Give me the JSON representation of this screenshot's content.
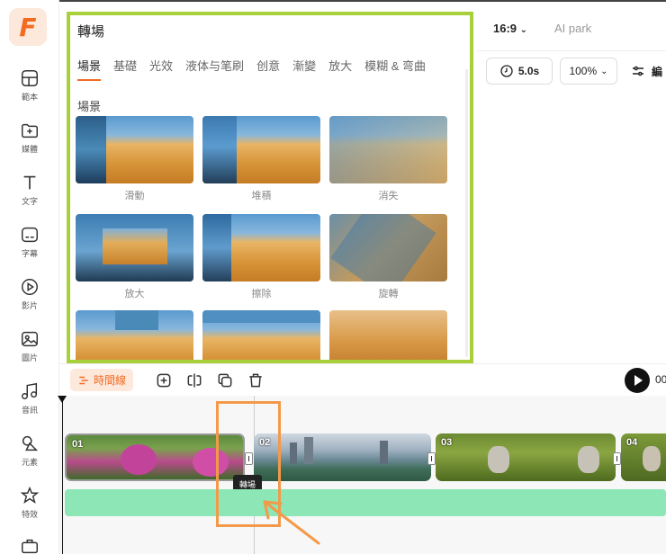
{
  "sidebar": {
    "logo": "F",
    "items": [
      {
        "label": "範本",
        "icon": "template-icon"
      },
      {
        "label": "媒體",
        "icon": "media-upload-icon"
      },
      {
        "label": "文字",
        "icon": "text-icon"
      },
      {
        "label": "字幕",
        "icon": "subtitle-icon"
      },
      {
        "label": "影片",
        "icon": "video-icon"
      },
      {
        "label": "圖片",
        "icon": "image-icon"
      },
      {
        "label": "音訊",
        "icon": "music-icon"
      },
      {
        "label": "元素",
        "icon": "elements-icon"
      },
      {
        "label": "特效",
        "icon": "effects-icon"
      },
      {
        "label": "",
        "icon": "toolbox-icon"
      }
    ]
  },
  "panel": {
    "title": "轉場",
    "tabs": [
      "場景",
      "基礎",
      "光效",
      "液体与笔刷",
      "创意",
      "漸變",
      "放大",
      "模糊 & 弯曲"
    ],
    "active_tab": "場景",
    "section": "場景",
    "items": [
      {
        "label": "滑動"
      },
      {
        "label": "堆積"
      },
      {
        "label": "消失"
      },
      {
        "label": "放大"
      },
      {
        "label": "擦除"
      },
      {
        "label": "旋轉"
      },
      {
        "label": ""
      },
      {
        "label": ""
      },
      {
        "label": ""
      }
    ]
  },
  "toolbar": {
    "aspect_ratio": "16:9",
    "project_name": "AI park",
    "duration": "5.0s",
    "zoom": "100%",
    "adjust_label": "編"
  },
  "timeline": {
    "main_button": "時間線",
    "time": "00",
    "clips": [
      {
        "num": "01"
      },
      {
        "num": "02"
      },
      {
        "num": "03"
      },
      {
        "num": "04"
      }
    ],
    "tooltip": "轉場"
  },
  "colors": {
    "accent": "#f36b21",
    "panel_highlight": "#a8d03a",
    "audio_track": "#8ce6b6",
    "annotation": "#f39a4a"
  }
}
